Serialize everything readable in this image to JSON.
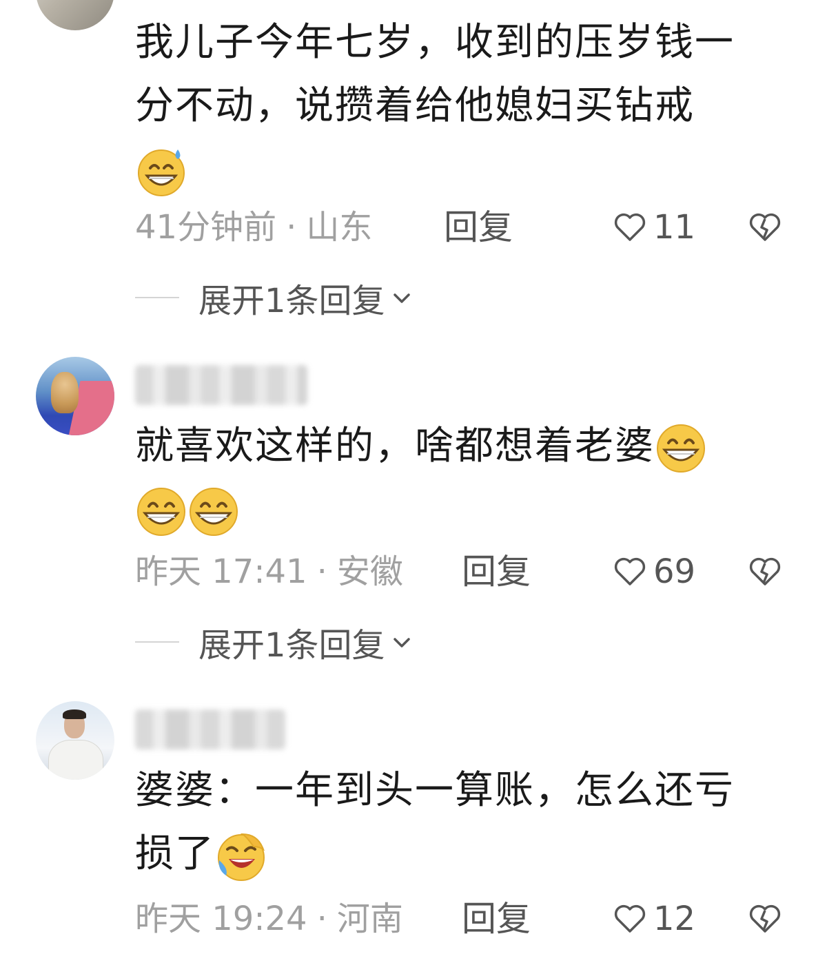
{
  "comments": [
    {
      "text_lines": [
        "我儿子今年七岁，收到的压岁钱一",
        "分不动，说攒着给他媳妇买钻戒"
      ],
      "emojis": [
        "sweat-grin-emoji"
      ],
      "time": "41分钟前",
      "dot": "·",
      "location": "山东",
      "reply_label": "回复",
      "likes": "11",
      "expand_label": "展开1条回复"
    },
    {
      "text_lines": [
        "就喜欢这样的，啥都想着老婆"
      ],
      "emojis": [
        "grin-emoji",
        "grin-emoji",
        "grin-emoji"
      ],
      "time": "昨天 17:41",
      "dot": "·",
      "location": "安徽",
      "reply_label": "回复",
      "likes": "69",
      "expand_label": "展开1条回复"
    },
    {
      "text_lines": [
        "婆婆：一年到头一算账，怎么还亏",
        "损了"
      ],
      "emojis": [
        "laugh-cry-emoji"
      ],
      "time": "昨天 19:24",
      "dot": "·",
      "location": "河南",
      "reply_label": "回复",
      "likes": "12"
    }
  ],
  "colors": {
    "text": "#1a1a1a",
    "meta": "#a0a0a0",
    "action": "#555555",
    "divider": "#d4d4d4"
  }
}
